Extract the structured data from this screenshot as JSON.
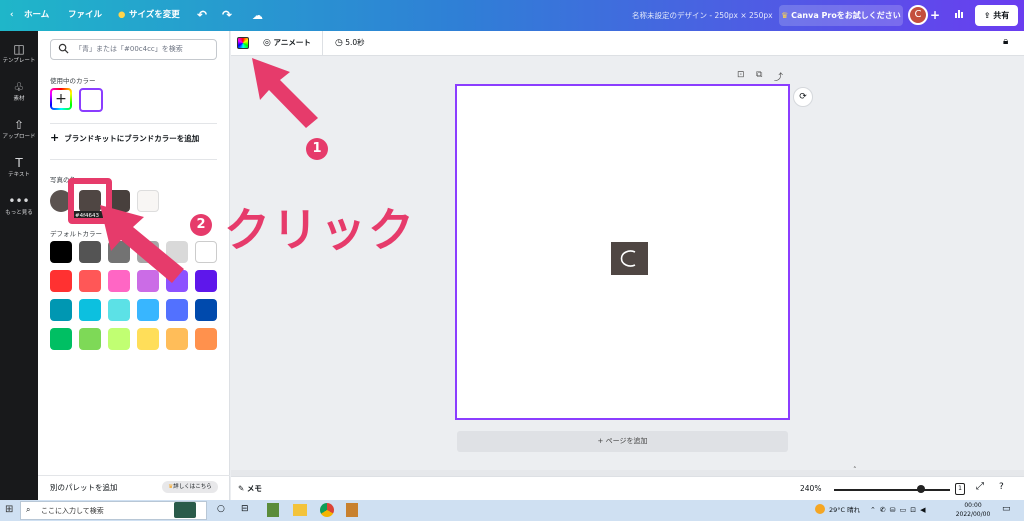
{
  "topbar": {
    "home_label": "ホーム",
    "file_label": "ファイル",
    "resize_label": "サイズを変更",
    "doc_title": "名称未設定のデザイン - 250px × 250px",
    "pro_button": "Canva Proをお試しください",
    "avatar_initial": "C",
    "share_label": "共有"
  },
  "sidebar": {
    "items": [
      {
        "label": "テンプレート",
        "icon": "template-icon"
      },
      {
        "label": "素材",
        "icon": "elements-icon"
      },
      {
        "label": "アップロード",
        "icon": "upload-icon"
      },
      {
        "label": "テキスト",
        "icon": "text-icon"
      },
      {
        "label": "もっと見る",
        "icon": "more-icon"
      }
    ]
  },
  "panel": {
    "search_placeholder": "「青」または「#00c4cc」を検索",
    "used_colors_label": "使用中のカラー",
    "add_brand_label": "ブランドキットにブランドカラーを追加",
    "photo_colors_label": "写真の色",
    "tooltip": "#4f4643",
    "default_colors_label": "デフォルトカラー",
    "add_palette_label": "別のパレットを追加",
    "learn_more_label": "詳しくはこちら",
    "used_colors": [
      "#ffffff"
    ],
    "photo_colors": [
      "#5b5350",
      "#4f4643",
      "#48403d",
      "#f8f6f4"
    ],
    "default_colors": [
      [
        "#000000",
        "#545454",
        "#737373",
        "#a6a6a6",
        "#d9d9d9",
        "#ffffff"
      ],
      [
        "#ff3131",
        "#ff5757",
        "#ff66c4",
        "#cb6ce6",
        "#8c52ff",
        "#5e17eb"
      ],
      [
        "#0097b2",
        "#0cc0df",
        "#5ce1e6",
        "#38b6ff",
        "#5271ff",
        "#004aad"
      ],
      [
        "#00bf63",
        "#7ed957",
        "#c1ff72",
        "#ffde59",
        "#ffbd59",
        "#ff914d"
      ]
    ]
  },
  "toolbar": {
    "animate_label": "アニメート",
    "duration_label": "5.0秒"
  },
  "canvas": {
    "add_page_label": "+ ページを追加",
    "logo_glyph": "C",
    "logo_color": "#4f4643"
  },
  "bottombar": {
    "notes_label": "メモ",
    "zoom_label": "240%",
    "page_count": "1"
  },
  "taskbar": {
    "search_placeholder": "ここに入力して検索",
    "weather": "29°C 晴れ",
    "time": "00:00",
    "date": "2022/00/00"
  },
  "annotation": {
    "step1": "1",
    "step2": "2",
    "click_label": "クリック",
    "accent_color": "#e63b6b"
  }
}
